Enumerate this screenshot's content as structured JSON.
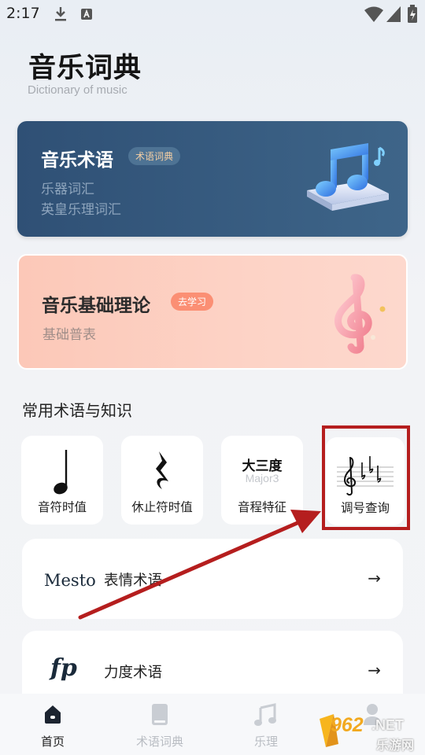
{
  "status_bar": {
    "time": "2:17"
  },
  "header": {
    "title": "音乐词典",
    "subtitle": "Dictionary of music"
  },
  "cards": {
    "dictionary": {
      "title": "音乐术语",
      "badge": "术语词典",
      "lines": [
        "乐器词汇",
        "英皇乐理词汇"
      ]
    },
    "theory": {
      "title": "音乐基础理论",
      "badge": "去学习",
      "lines": [
        "基础普表"
      ]
    }
  },
  "section": {
    "title": "常用术语与知识"
  },
  "tiles": [
    {
      "label": "音符时值",
      "icon": "quarter-note-icon"
    },
    {
      "label": "休止符时值",
      "icon": "quarter-rest-icon"
    },
    {
      "label": "音程特征",
      "glyph_title": "大三度",
      "glyph_sub": "Major3"
    },
    {
      "label": "调号查询",
      "icon": "key-signature-icon"
    }
  ],
  "rows": [
    {
      "logo": "Mesto",
      "label": "表情术语",
      "arrow": "→"
    },
    {
      "logo": "fp",
      "label": "力度术语",
      "arrow": "→"
    }
  ],
  "tabbar": [
    {
      "label": "首页",
      "icon": "home-icon",
      "active": true
    },
    {
      "label": "术语词典",
      "icon": "book-icon",
      "active": false
    },
    {
      "label": "乐理",
      "icon": "music-note-icon",
      "active": false
    },
    {
      "label": "",
      "icon": "profile-icon",
      "active": false
    }
  ],
  "watermark": {
    "number": "962",
    "suffix": ".NET",
    "site": "乐游网"
  },
  "colors": {
    "dict_card": "#2f5075",
    "theory_card": "#fcc8b8",
    "theory_badge": "#fb8f74",
    "highlight": "#b51e1e"
  }
}
